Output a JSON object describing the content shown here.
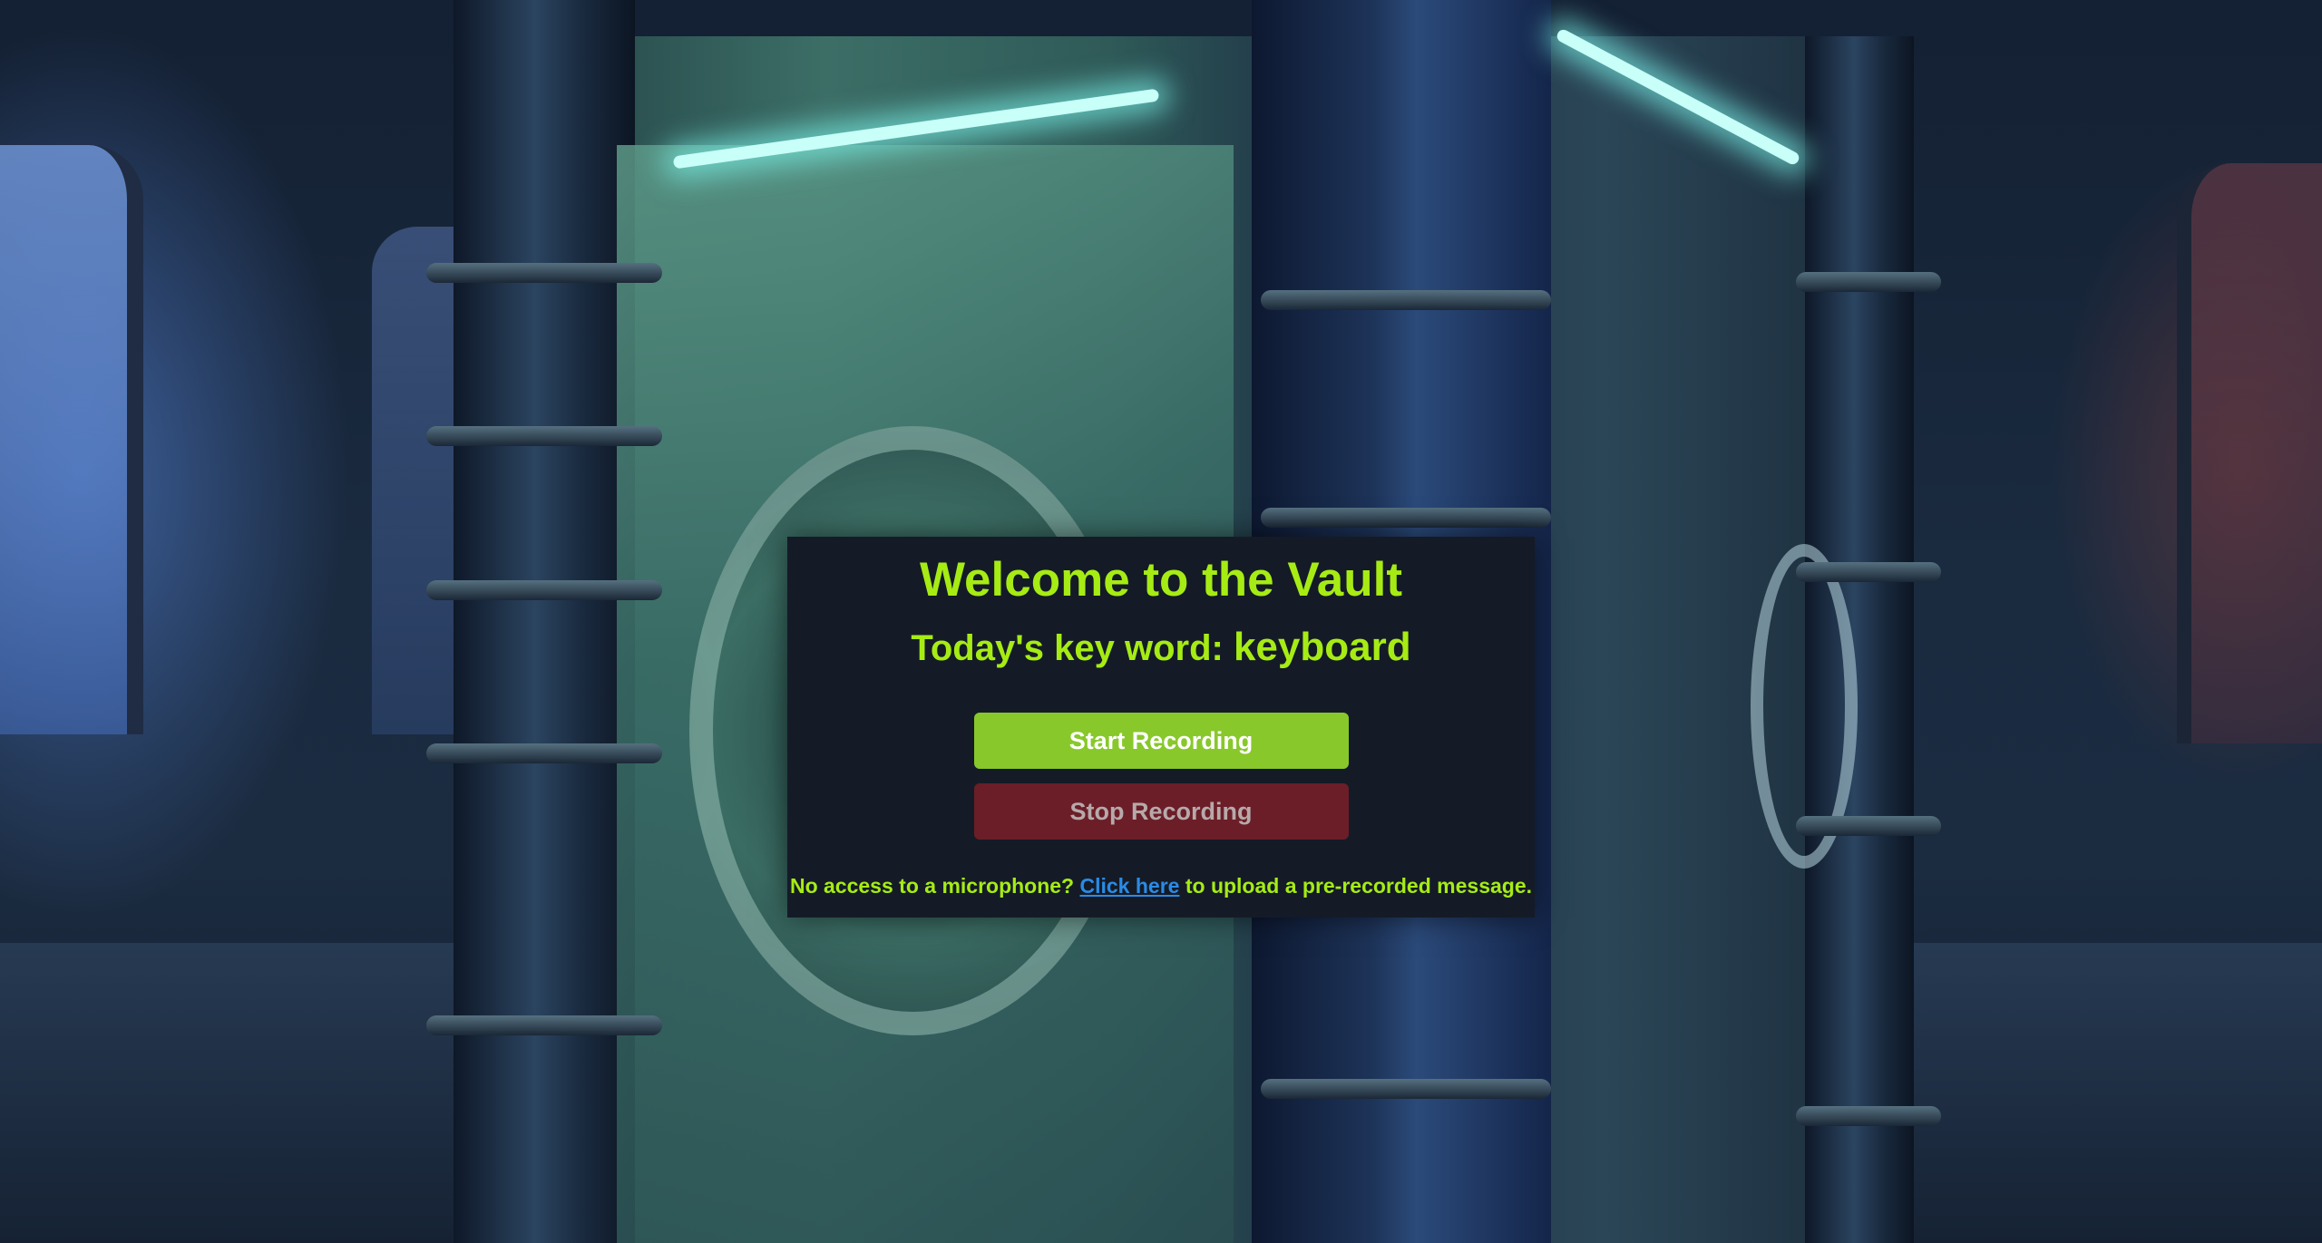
{
  "vault": {
    "title": "Welcome to the Vault",
    "keyword_prefix": "Today's key word: ",
    "keyword": "keyboard",
    "start_button": "Start Recording",
    "stop_button": "Stop Recording",
    "footer_before": "No access to a microphone? ",
    "footer_link": "Click here",
    "footer_after": " to upload a pre-recorded message."
  },
  "colors": {
    "accent": "#a6ec14",
    "start_button": "#88c82b",
    "stop_button": "#6b1e27",
    "card_background": "#141b27",
    "link": "#2a8be6"
  },
  "background": {
    "icon": "vault-door-scene-image"
  }
}
